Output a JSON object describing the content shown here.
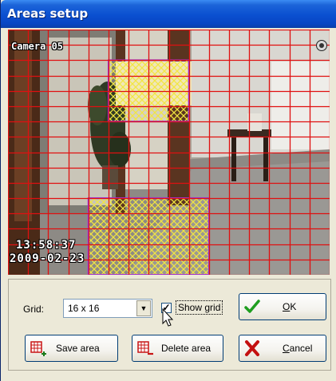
{
  "window": {
    "title": "Areas setup"
  },
  "camera": {
    "name": "Camera 05",
    "time": "13:58:37",
    "date": "2009-02-23",
    "grid_color": "#e01010",
    "area_color": "#9a32e0",
    "area_fill_color": "#f2e640"
  },
  "controls": {
    "grid_label": "Grid:",
    "grid_value": "16 x 16",
    "show_grid_label": "Show grid",
    "show_grid_checked": true
  },
  "buttons": {
    "ok_prefix": "",
    "ok_hotkey": "O",
    "ok_suffix": "K",
    "cancel_hotkey": "C",
    "cancel_suffix": "ancel",
    "save_area": "Save area",
    "delete_area": "Delete area"
  },
  "icons": {
    "ok": "checkmark-icon",
    "cancel": "red-x-icon",
    "save_area": "table-plus-icon",
    "delete_area": "table-minus-icon",
    "dropdown": "chevron-down-icon"
  }
}
